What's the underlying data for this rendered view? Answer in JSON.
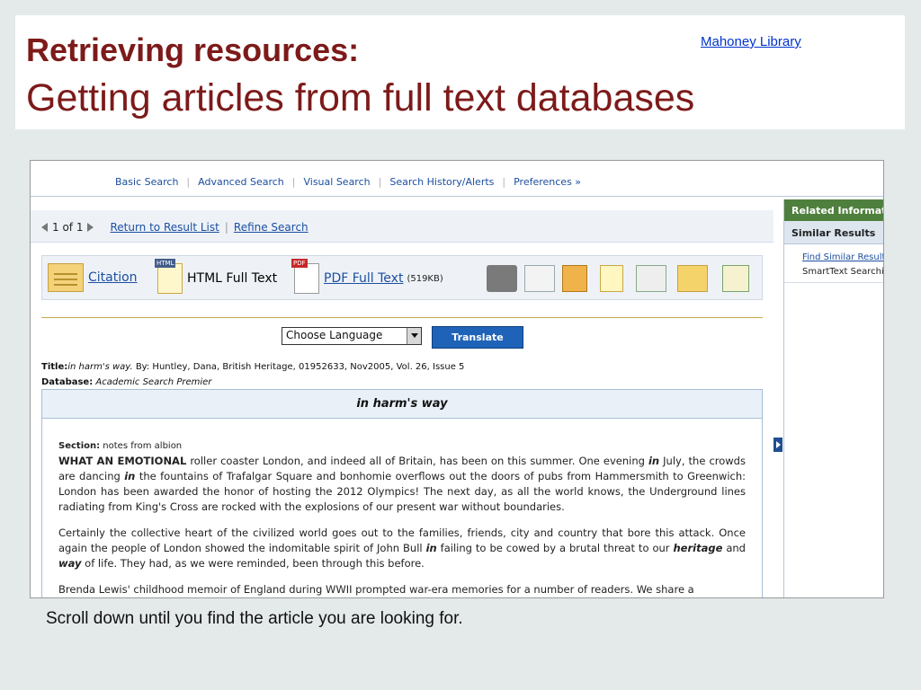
{
  "slide": {
    "title_line1": "Retrieving resources:",
    "title_line2": "Getting articles from full text databases",
    "library_link": "Mahoney Library",
    "caption": "Scroll down until you find the article you are looking for."
  },
  "topnav": {
    "items": [
      "Basic Search",
      "Advanced Search",
      "Visual Search",
      "Search History/Alerts",
      "Preferences »"
    ]
  },
  "pager": {
    "count_text": "1 of 1",
    "return_link": "Return to Result List",
    "refine_link": "Refine Search"
  },
  "toolbar": {
    "citation": "Citation",
    "html_tag": "HTML",
    "html_full_text": "HTML Full Text",
    "pdf_tag": "PDF",
    "pdf_full_text": "PDF Full Text",
    "pdf_size": "(519KB)"
  },
  "translate": {
    "language_selected": "Choose Language",
    "button_label": "Translate"
  },
  "meta": {
    "title_label": "Title:",
    "title_value": "in harm's way.",
    "title_rest": " By: Huntley, Dana, British Heritage, 01952633, Nov2005, Vol. 26, Issue 5",
    "database_label": "Database:",
    "database_value": "Academic Search Premier"
  },
  "article": {
    "heading": "in harm's way",
    "section_label": "Section:",
    "section_value": " notes from albion",
    "p1_lead": "WHAT AN EMOTIONAL",
    "p1_a": " roller coaster London, and indeed all of Britain, has been on this summer. One evening ",
    "p1_in1": "in",
    "p1_b": " July, the crowds are dancing ",
    "p1_in2": "in",
    "p1_c": " the fountains of Trafalgar Square and bonhomie overflows out the doors of pubs from Hammersmith to Greenwich: London has been awarded the honor of hosting the 2012 Olympics! The next day, as all the world knows, the Underground lines radiating from King's Cross are rocked with the explosions of our present war without boundaries.",
    "p2_a": "Certainly the collective heart of the civilized world goes out to the families, friends, city and country that bore this attack. Once again the people of London showed the indomitable spirit of John Bull ",
    "p2_in": "in",
    "p2_b": " failing to be cowed by a brutal threat to our ",
    "p2_heritage": "heritage",
    "p2_c": " and ",
    "p2_way": "way",
    "p2_d": " of life. They had, as we were reminded, been through this before.",
    "p3": "Brenda Lewis' childhood memoir of England during WWII prompted war-era memories for a number of readers. We share a"
  },
  "right_panel": {
    "header": "Related Information",
    "subheader": "Similar Results",
    "link": "Find Similar Results",
    "text": "SmartText Searching"
  }
}
